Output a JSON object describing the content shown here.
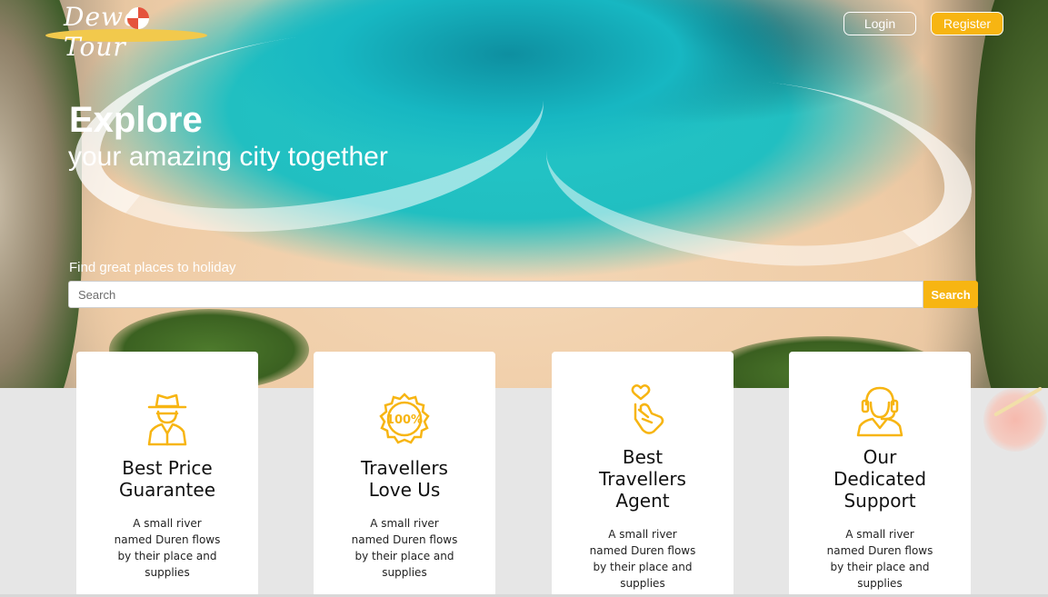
{
  "brand": {
    "logo_text": "Dewe Tour"
  },
  "nav": {
    "login_label": "Login",
    "register_label": "Register"
  },
  "hero": {
    "title": "Explore",
    "subtitle": "your amazing city together",
    "search_label": "Find great places to holiday",
    "search_placeholder": "Search",
    "search_value": "",
    "search_button_label": "Search"
  },
  "features": [
    {
      "icon": "detective-icon",
      "title": "Best Price Guarantee",
      "text": "A small river named Duren flows by their place and supplies"
    },
    {
      "icon": "hundred-percent-badge-icon",
      "title": "Travellers Love Us",
      "text": "A small river named Duren flows by their place and supplies"
    },
    {
      "icon": "finger-heart-icon",
      "title": "Best Travellers Agent",
      "text": "A small river named Duren flows by their place and supplies"
    },
    {
      "icon": "support-agent-icon",
      "title": "Our Dedicated Support",
      "text": "A small river named Duren flows by their place and supplies"
    }
  ],
  "colors": {
    "accent": "#f7b512",
    "background": "#e6e6e6",
    "card": "#ffffff"
  }
}
